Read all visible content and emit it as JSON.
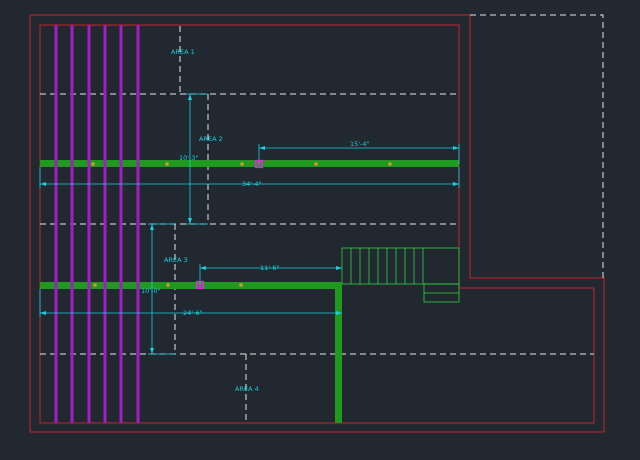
{
  "colors": {
    "background": "#212830",
    "boundary": "#c8232c",
    "dashed": "#e6e6e6",
    "dimension": "#19d0e0",
    "beam": "#1f9a1f",
    "beam_dark": "#0e6b0e",
    "joist": "#a21fbf",
    "node": "#d19a2f",
    "grip": "#e02ad8",
    "stair": "#2fd13b"
  },
  "areas": {
    "a1": "AREA 1",
    "a2": "AREA 2",
    "a3": "AREA 3",
    "a4": "AREA 4"
  },
  "dimensions": {
    "d_15_4": "15'-4\"",
    "d_10_3": "10'-3\"",
    "d_34_4": "34'-4\"",
    "d_11_6": "11'-6\"",
    "d_10_0": "10'-0\"",
    "d_24_6": "24'-6\""
  },
  "icons": {
    "grip_a": "grip-square-icon",
    "grip_b": "grip-square-icon"
  }
}
